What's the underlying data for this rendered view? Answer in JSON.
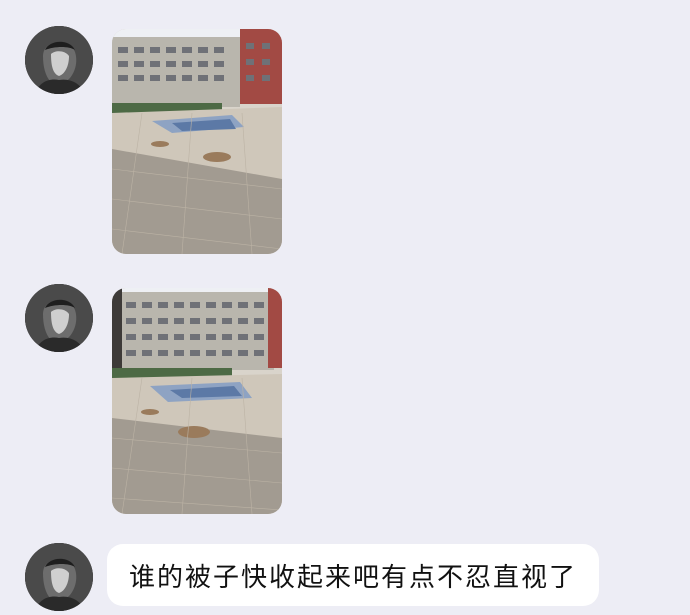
{
  "chat": {
    "messages": [
      {
        "type": "image",
        "image_description": "photo-campus-building-blankets-1"
      },
      {
        "type": "image",
        "image_description": "photo-campus-building-blankets-2"
      },
      {
        "type": "text",
        "text": "谁的被子快收起来吧有点不忍直视了"
      }
    ]
  },
  "colors": {
    "background": "#ededf5",
    "bubble": "#ffffff",
    "text": "#111111"
  }
}
